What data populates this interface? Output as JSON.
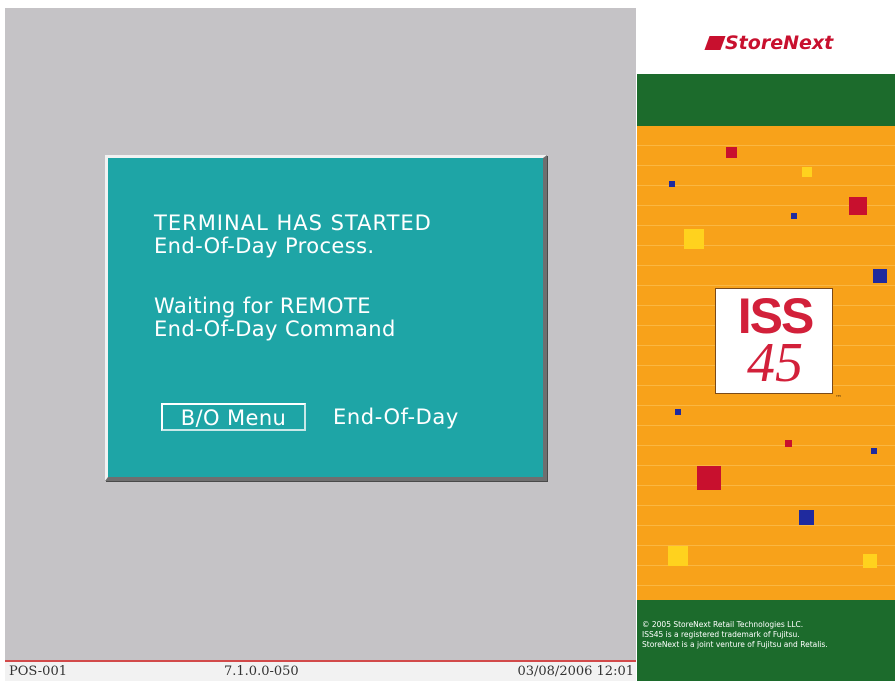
{
  "dialog": {
    "line1": "TERMINAL HAS STARTED",
    "line2": "End-Of-Day Process.",
    "line3": "Waiting for REMOTE",
    "line4": "End-Of-Day Command",
    "bo_menu_button": "B/O Menu",
    "eod_label": "End-Of-Day"
  },
  "status_bar": {
    "terminal": "POS-001",
    "version": "7.1.0.0-050",
    "datetime": "03/08/2006 12:01"
  },
  "brand": {
    "logo_text": "StoreNext",
    "product_line1": "ISS",
    "product_line2": "45",
    "trademark": "™",
    "copyright_lines": [
      "© 2005 StoreNext Retail Technologies LLC.",
      "ISS45 is a registered trademark of Fujitsu.",
      "StoreNext is a joint venture of Fujitsu and Retalis."
    ]
  },
  "colors": {
    "screen_bg": "#c5c3c6",
    "dialog_bg": "#1ea5a6",
    "brand_green": "#1c6b2c",
    "brand_orange": "#f8a21a",
    "brand_red": "#c8102e"
  }
}
